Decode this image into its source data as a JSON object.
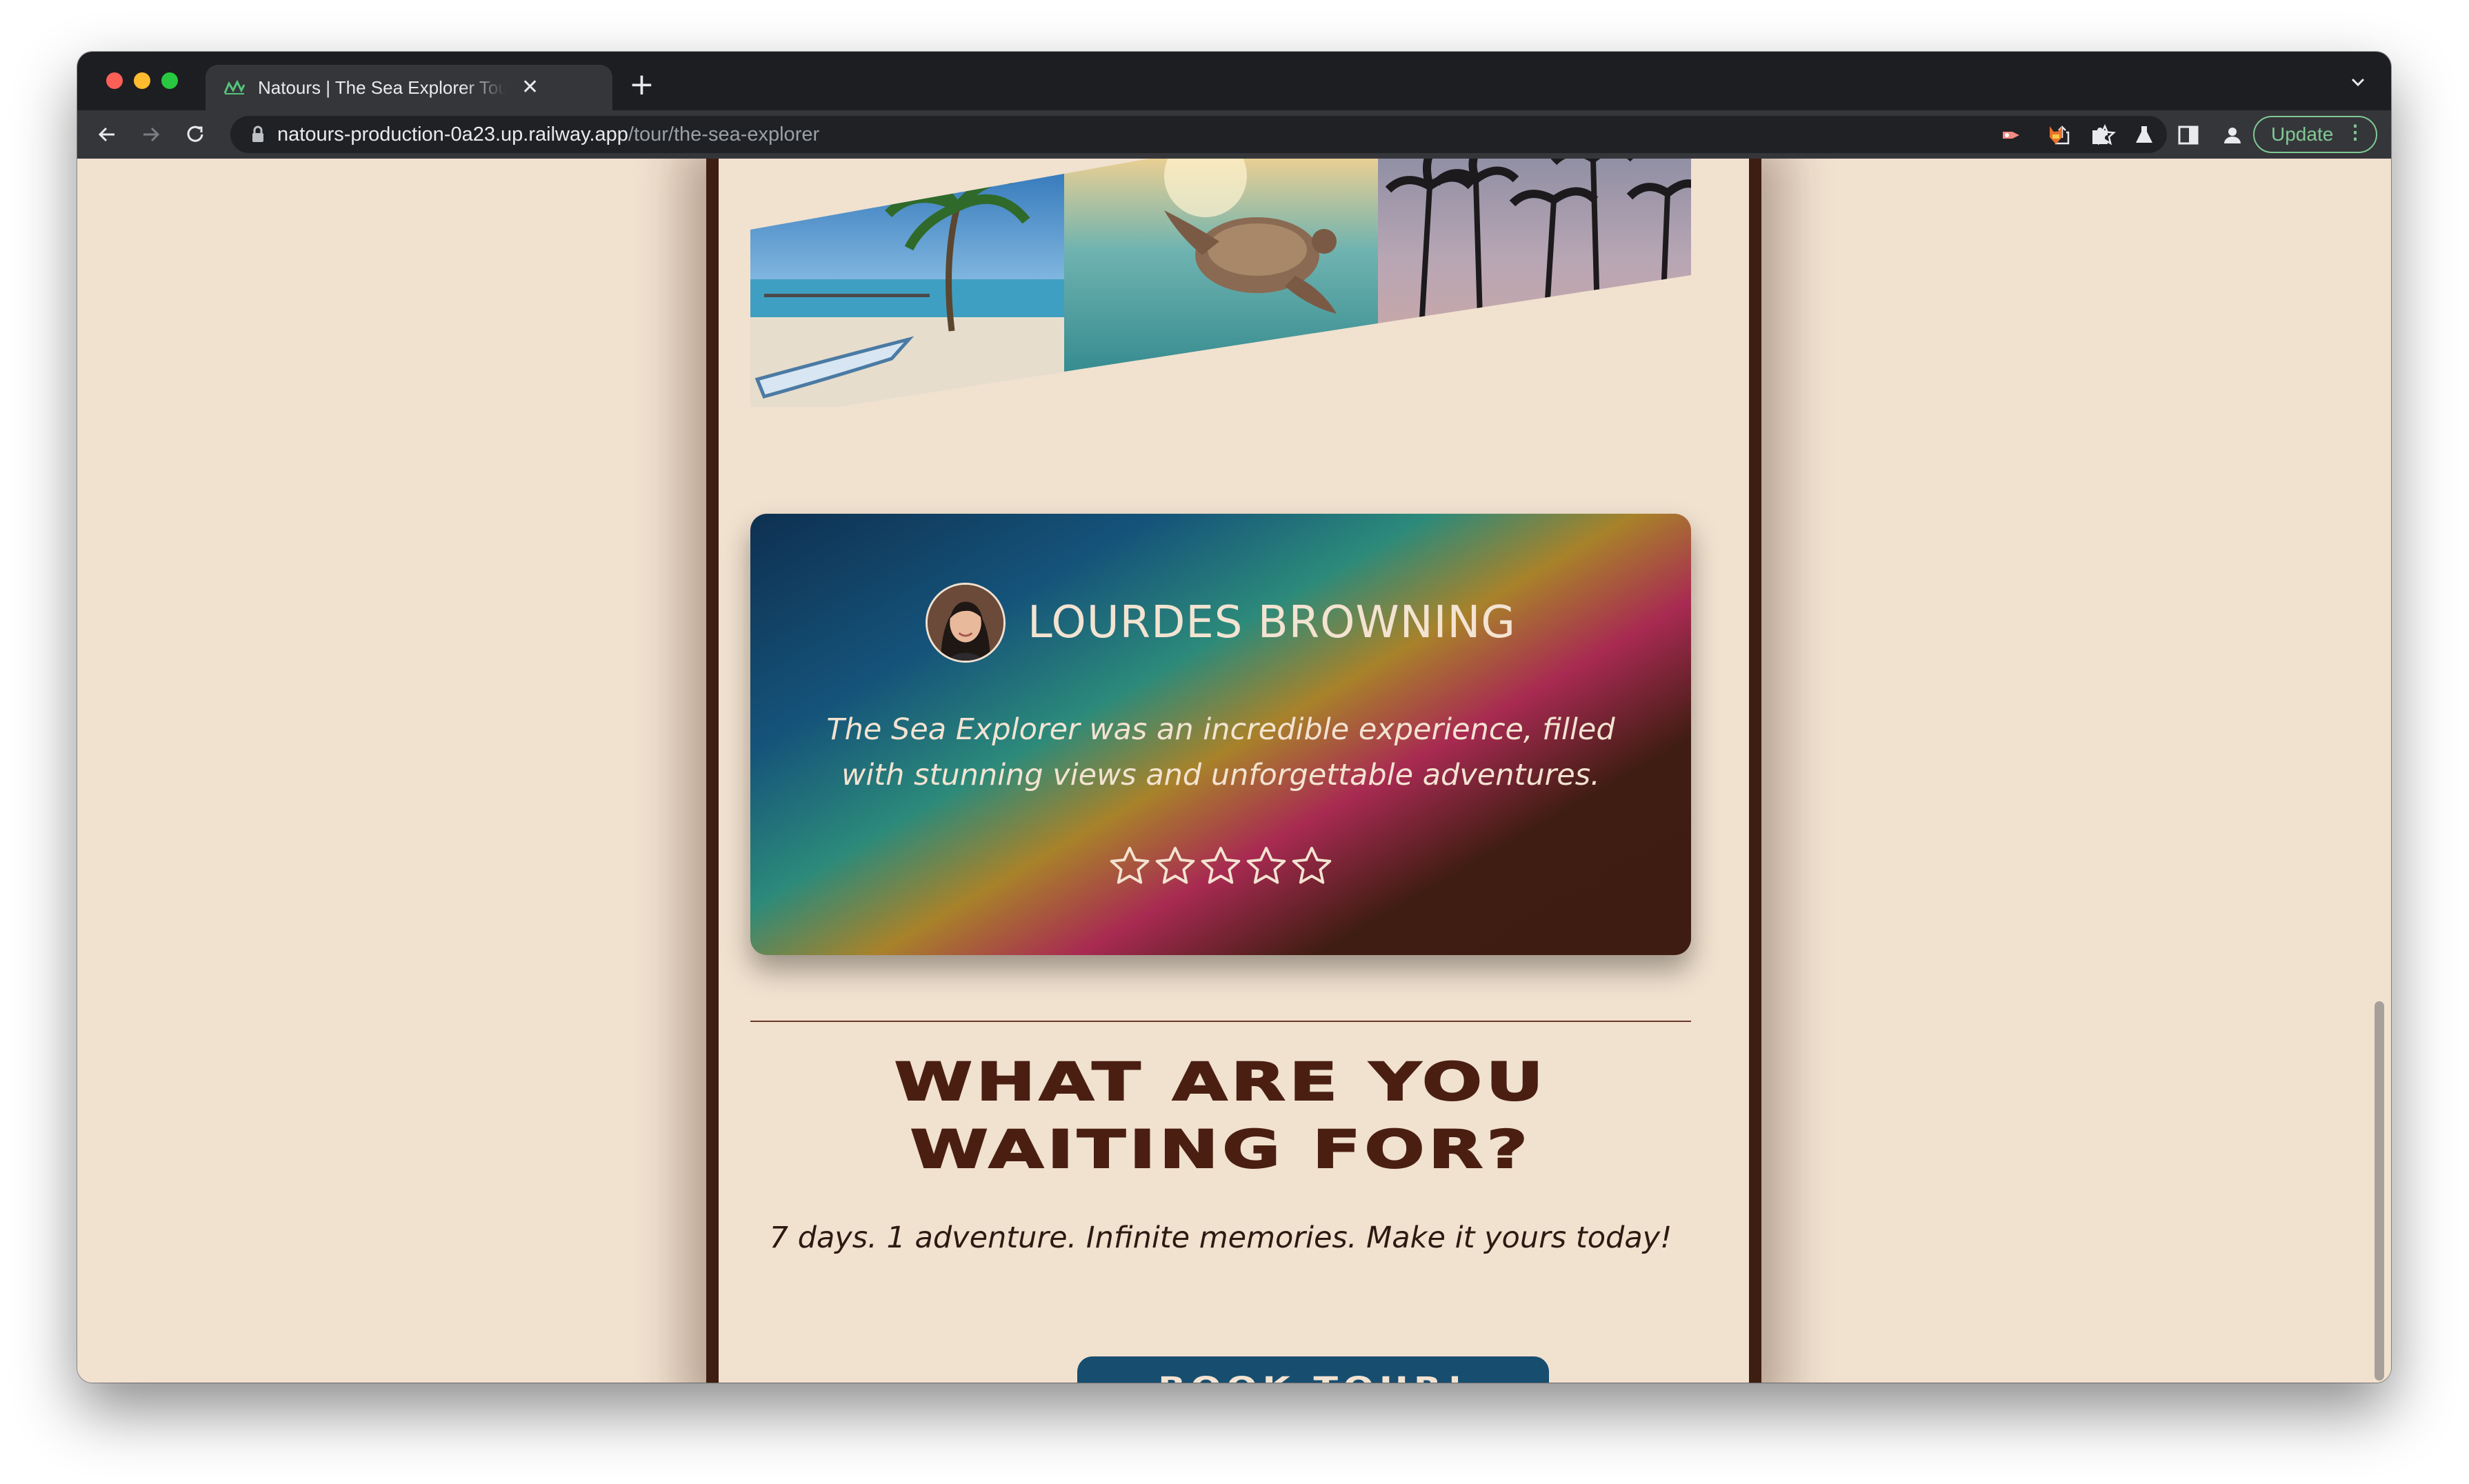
{
  "browser": {
    "tab": {
      "title": "Natours | The Sea Explorer Tour",
      "close": "✕"
    },
    "new_tab": "+",
    "url": {
      "host": "natours-production-0a23.up.railway.app",
      "path": "/tour/the-sea-explorer"
    },
    "update_button": "Update",
    "update_menu": "⋮"
  },
  "page": {
    "review": {
      "name": "LOURDES BROWNING",
      "text": "The Sea Explorer was an incredible experience, filled with stunning views and unforgettable adventures.",
      "rating": 5,
      "rating_max": 5
    },
    "cta": {
      "title_line1": "WHAT ARE YOU",
      "title_line2": "WAITING FOR?",
      "text": "7 days. 1 adventure. Infinite memories. Make it yours today!",
      "button": "BOOK TOUR!"
    }
  },
  "colors": {
    "page_bg": "#f1e1cf",
    "card_border": "#3e1e12",
    "button_bg": "#174e70",
    "cta_title": "#4a1f12"
  }
}
